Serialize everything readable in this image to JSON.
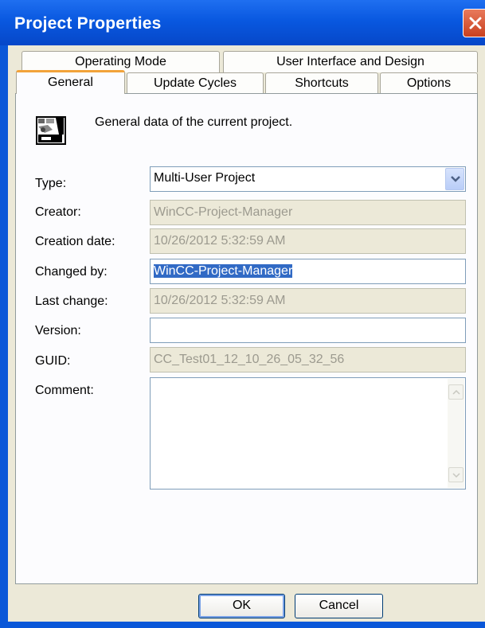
{
  "window": {
    "title": "Project Properties"
  },
  "tabs": {
    "row_back": [
      "Operating Mode",
      "User Interface and Design"
    ],
    "row_front": [
      "General",
      "Update Cycles",
      "Shortcuts",
      "Options"
    ],
    "active": "General"
  },
  "general": {
    "description": "General data of the current project.",
    "type_label": "Type:",
    "type_value": "Multi-User Project",
    "creator_label": "Creator:",
    "creator_value": "WinCC-Project-Manager",
    "creation_date_label": "Creation date:",
    "creation_date_value": "10/26/2012 5:32:59 AM",
    "changed_by_label": "Changed by:",
    "changed_by_value": "WinCC-Project-Manager",
    "last_change_label": "Last change:",
    "last_change_value": "10/26/2012 5:32:59 AM",
    "version_label": "Version:",
    "version_value": "",
    "guid_label": "GUID:",
    "guid_value": "CC_Test01_12_10_26_05_32_56",
    "comment_label": "Comment:",
    "comment_value": ""
  },
  "buttons": {
    "ok": "OK",
    "cancel": "Cancel"
  },
  "colors": {
    "titlebar": "#0a57d8",
    "dialog_bg": "#ece9d8",
    "selection": "#316ac5",
    "active_tab_accent": "#f2a33a"
  }
}
